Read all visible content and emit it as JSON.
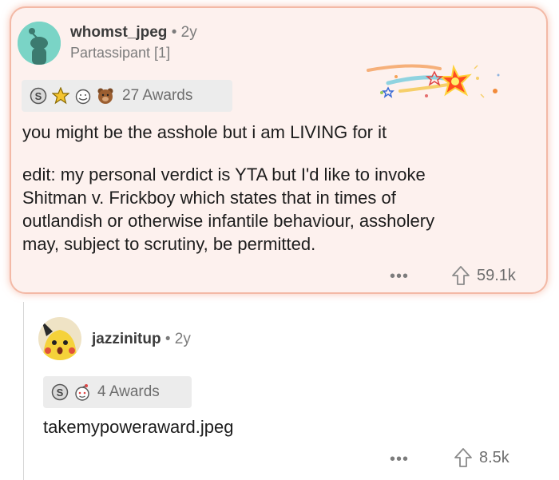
{
  "comment1": {
    "username": "whomst_jpeg",
    "separator": "•",
    "age": "2y",
    "flair": "Partassipant [1]",
    "awards_label": "27 Awards",
    "text_line1": "you might be the asshole but i am LIVING for it",
    "edit_lines": [
      "edit: my personal verdict is YTA but I'd like to invoke",
      "Shitman v. Frickboy which states that in times of",
      "outlandish or otherwise infantile behaviour, assholery",
      "may, subject to scrutiny, be permitted."
    ],
    "more": "•••",
    "votes": "59.1k"
  },
  "comment2": {
    "username": "jazzinitup",
    "separator": "•",
    "age": "2y",
    "awards_label": "4 Awards",
    "text": "takemypoweraward.jpeg",
    "more": "•••",
    "votes": "8.5k"
  },
  "colors": {
    "card_bg": "#fdf1ee",
    "card_border": "#f3b9a6",
    "avatar_teal": "#7ad4c6",
    "avatar_yellow": "#f5d23a"
  },
  "icons": {
    "award1": "silver-award-icon",
    "award2": "gold-star-award-icon",
    "award3": "wholesome-award-icon",
    "award4": "bear-award-icon",
    "upvote": "upvote-arrow-icon",
    "more": "more-dots-icon"
  }
}
